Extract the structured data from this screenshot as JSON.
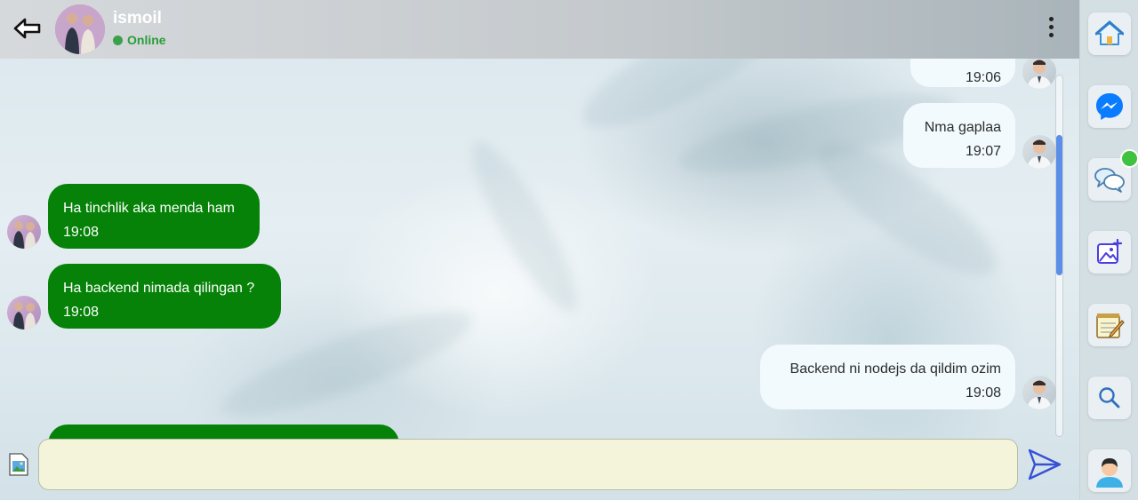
{
  "header": {
    "contact_name": "ismoil",
    "status": "Online",
    "status_color": "#3aa14a"
  },
  "messages": [
    {
      "direction": "outgoing",
      "text": "",
      "time": "19:06",
      "partial": true
    },
    {
      "direction": "outgoing",
      "text": "Nma gaplaa",
      "time": "19:07"
    },
    {
      "direction": "incoming",
      "text": "Ha tinchlik aka menda ham",
      "time": "19:08"
    },
    {
      "direction": "incoming",
      "text": "Ha backend nimada qilingan ?",
      "time": "19:08"
    },
    {
      "direction": "outgoing",
      "text": "Backend ni nodejs da qildim ozim",
      "time": "19:08"
    },
    {
      "direction": "incoming",
      "text": "",
      "time": "",
      "partial": true
    }
  ],
  "composer": {
    "placeholder": "",
    "value": ""
  },
  "sidebar": {
    "items": [
      {
        "name": "home",
        "icon": "home-icon"
      },
      {
        "name": "messenger",
        "icon": "messenger-icon"
      },
      {
        "name": "chats",
        "icon": "chat-bubbles-icon",
        "has_notification": true
      },
      {
        "name": "add-image",
        "icon": "add-image-icon"
      },
      {
        "name": "notes",
        "icon": "notepad-icon"
      },
      {
        "name": "search",
        "icon": "search-icon"
      },
      {
        "name": "profile",
        "icon": "user-avatar-icon"
      }
    ]
  },
  "colors": {
    "incoming_bubble": "#058207",
    "outgoing_bubble": "#f2fafd",
    "accent": "#5a8ee8",
    "online": "#3aa14a"
  }
}
